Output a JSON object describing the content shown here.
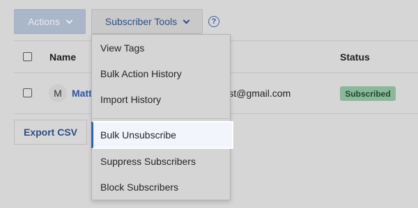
{
  "toolbar": {
    "actions_label": "Actions",
    "subscriber_tools_label": "Subscriber Tools",
    "help_glyph": "?"
  },
  "table": {
    "headers": {
      "name": "Name",
      "status": "Status"
    },
    "row": {
      "avatar_initial": "M",
      "name": "Matt",
      "email": "rtest@gmail.com",
      "status": "Subscribed"
    }
  },
  "export_label": "Export CSV",
  "menu": {
    "items": [
      "View Tags",
      "Bulk Action History",
      "Import History",
      "Bulk Unsubscribe",
      "Suppress Subscribers",
      "Block Subscribers"
    ],
    "highlighted_index": 3
  },
  "colors": {
    "accent": "#2c62c8",
    "badge_bg": "#8bb79b"
  }
}
